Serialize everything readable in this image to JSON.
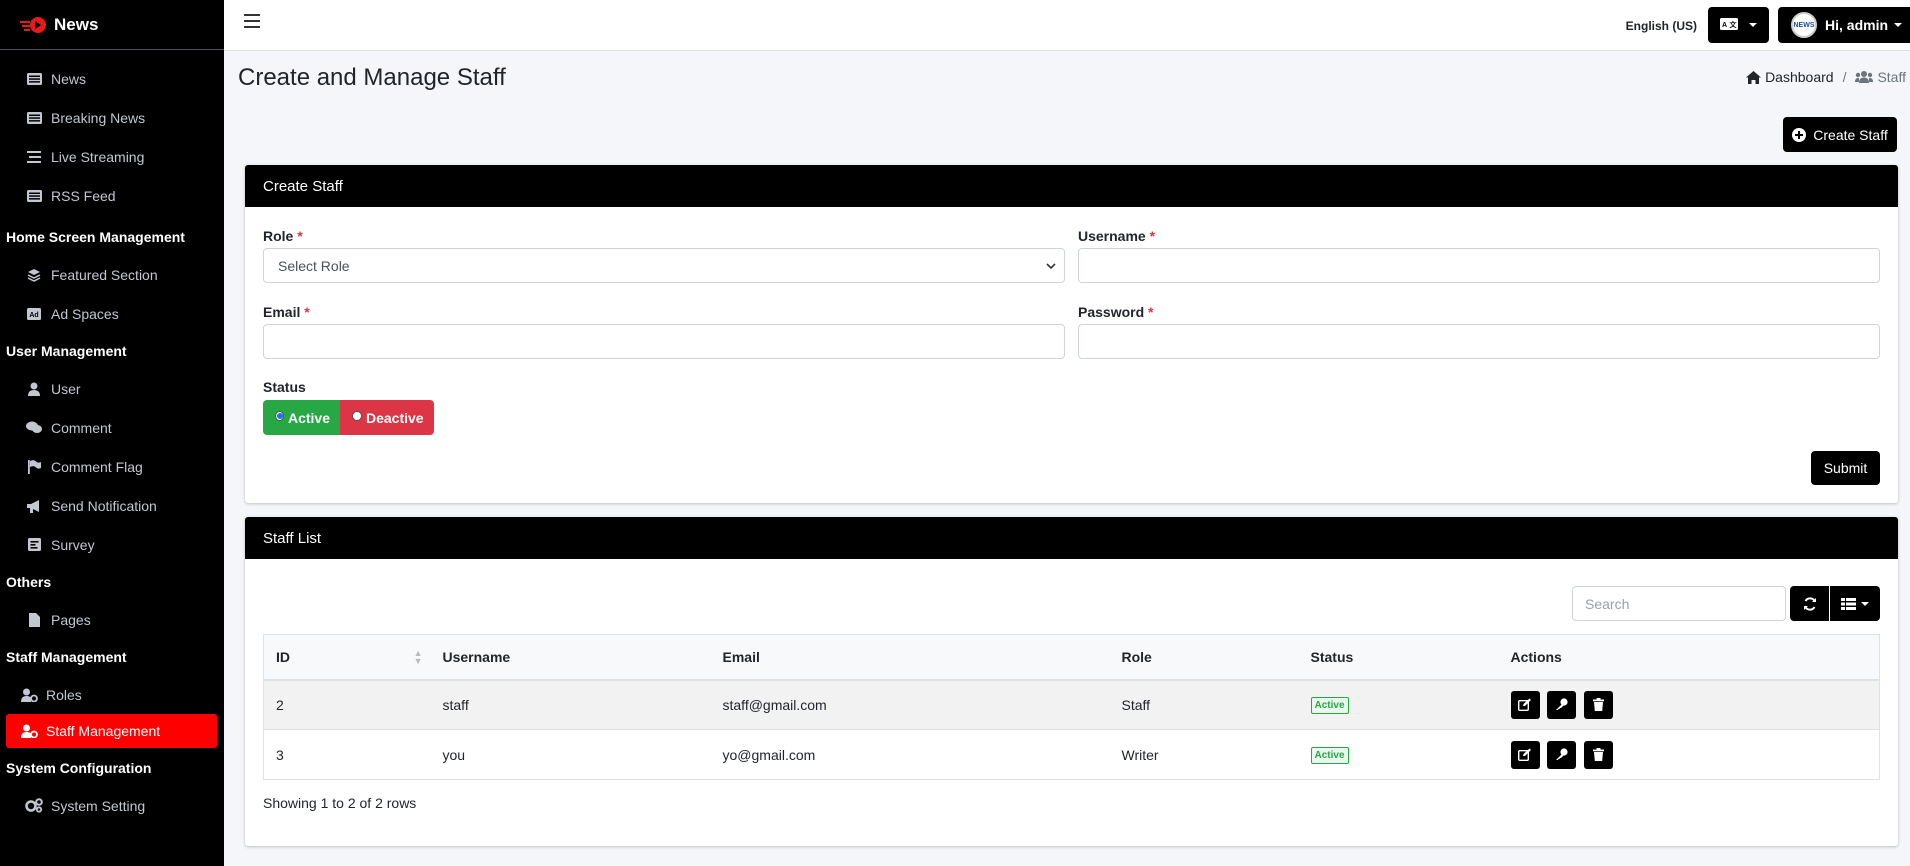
{
  "brand": {
    "name": "News"
  },
  "sidebar": {
    "items_top": [
      {
        "label": "News",
        "icon": "list-icon"
      },
      {
        "label": "Breaking News",
        "icon": "list-icon"
      },
      {
        "label": "Live Streaming",
        "icon": "stream-icon"
      },
      {
        "label": "RSS Feed",
        "icon": "list-icon"
      }
    ],
    "sections": [
      {
        "header": "Home Screen Management",
        "items": [
          {
            "label": "Featured Section"
          },
          {
            "label": "Ad Spaces"
          }
        ]
      },
      {
        "header": "User Management",
        "items": [
          {
            "label": "User"
          },
          {
            "label": "Comment"
          },
          {
            "label": "Comment Flag"
          },
          {
            "label": "Send Notification"
          },
          {
            "label": "Survey"
          }
        ]
      },
      {
        "header": "Others",
        "items": [
          {
            "label": "Pages"
          }
        ]
      },
      {
        "header": "Staff Management",
        "items": [
          {
            "label": "Roles"
          },
          {
            "label": "Staff Management"
          }
        ]
      },
      {
        "header": "System Configuration",
        "items": [
          {
            "label": "System Setting"
          }
        ]
      }
    ]
  },
  "topbar": {
    "language": "English (US)",
    "greeting": "Hi, admin",
    "avatar_text": "NEWS"
  },
  "page": {
    "title": "Create and Manage Staff",
    "breadcrumb": {
      "home": "Dashboard",
      "sep": "/",
      "current": "Staff"
    },
    "create_button": "Create Staff"
  },
  "form": {
    "title": "Create Staff",
    "role_label": "Role",
    "role_placeholder": "Select Role",
    "username_label": "Username",
    "email_label": "Email",
    "password_label": "Password",
    "required_mark": "*",
    "status_label": "Status",
    "status_active": "Active",
    "status_deactive": "Deactive",
    "submit": "Submit"
  },
  "list": {
    "title": "Staff List",
    "search_placeholder": "Search",
    "columns": [
      "ID",
      "Username",
      "Email",
      "Role",
      "Status",
      "Actions"
    ],
    "rows": [
      {
        "id": "2",
        "username": "staff",
        "email": "staff@gmail.com",
        "role": "Staff",
        "status": "Active"
      },
      {
        "id": "3",
        "username": "you",
        "email": "yo@gmail.com",
        "role": "Writer",
        "status": "Active"
      }
    ],
    "showing": "Showing 1 to 2 of 2 rows"
  },
  "colors": {
    "sidebar_bg": "#000000",
    "active_item": "#ff0000",
    "success": "#28a745",
    "danger": "#dc3545"
  }
}
